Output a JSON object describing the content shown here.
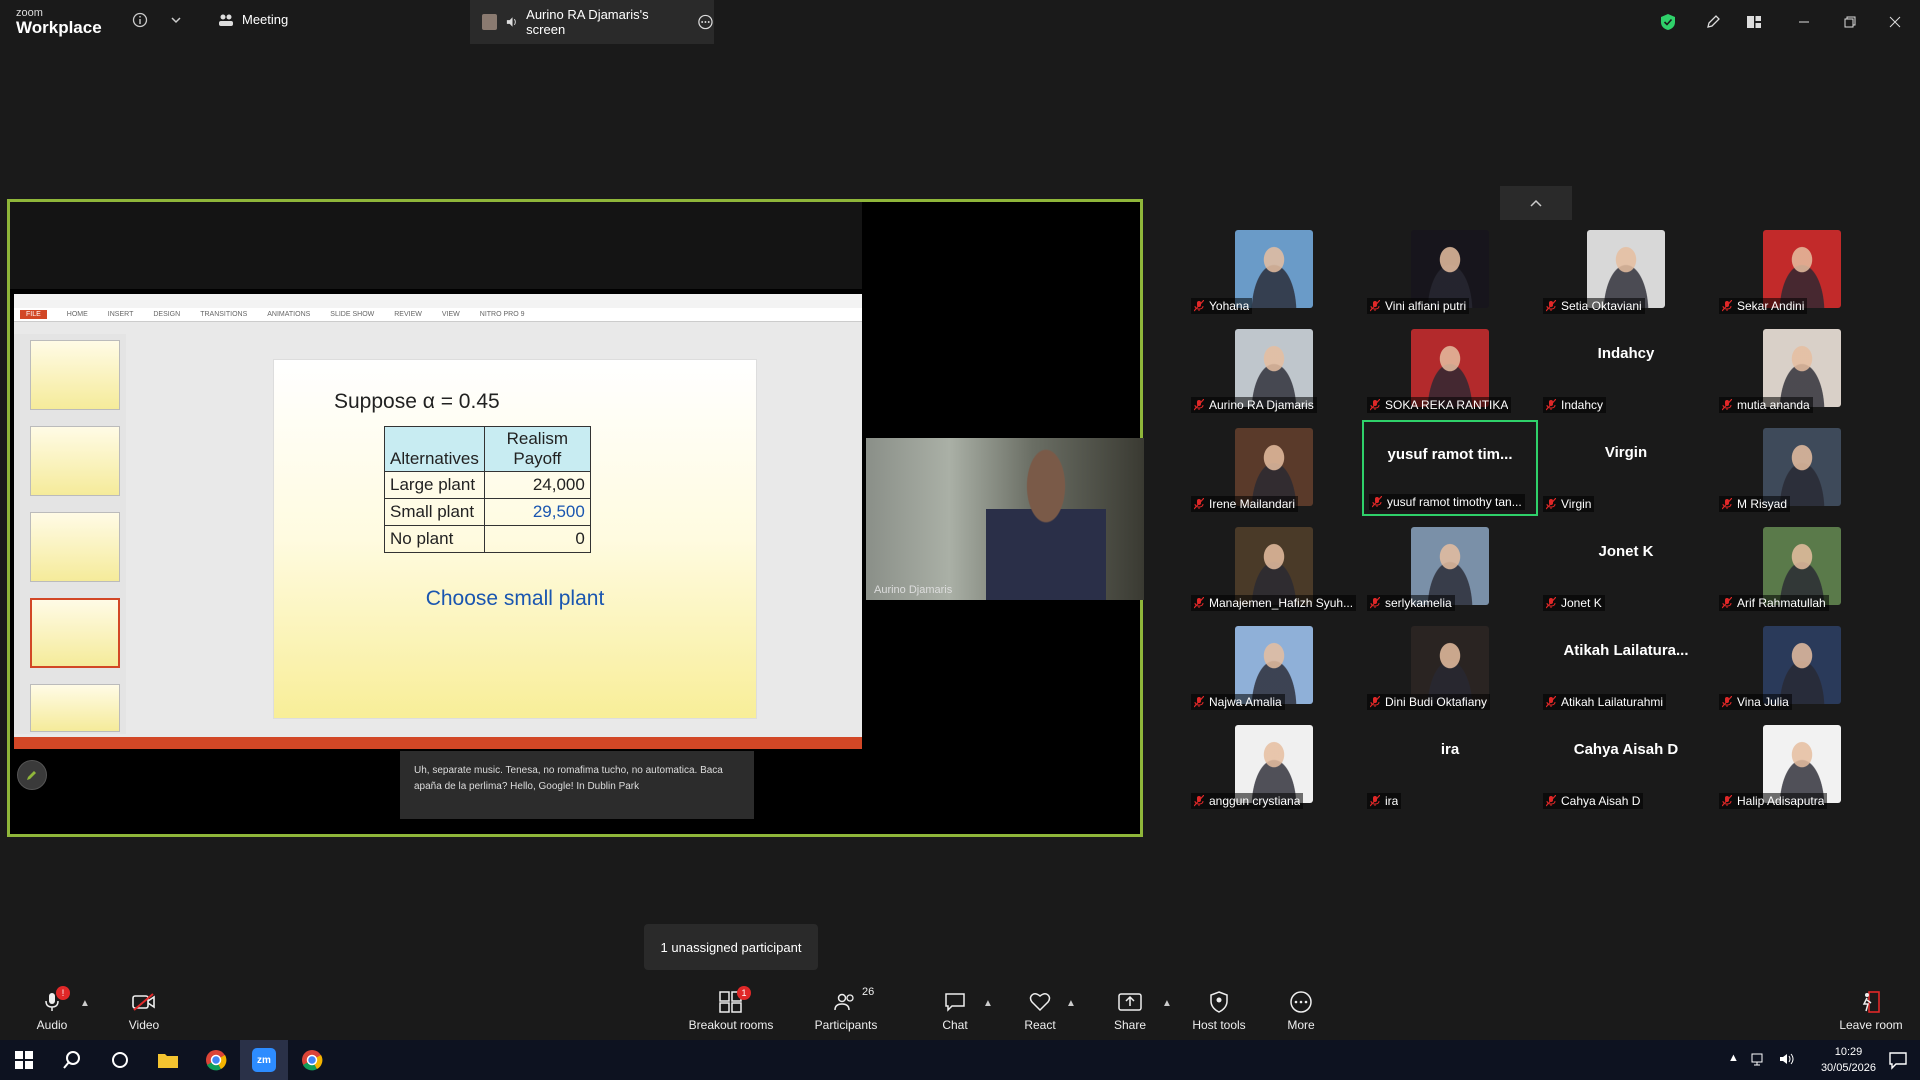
{
  "app": {
    "brand_top": "zoom",
    "brand_bottom": "Workplace"
  },
  "titlebar": {
    "meeting_label": "Meeting",
    "screen_tab_label": "Aurino RA Djamaris's screen"
  },
  "slide": {
    "heading": "Suppose α = 0.45",
    "table": {
      "col1_header": "Alternatives",
      "col2_header": "Realism Payoff",
      "rows": [
        {
          "alt": "Large plant",
          "val": "24,000"
        },
        {
          "alt": "Small plant",
          "val": "29,500"
        },
        {
          "alt": "No plant",
          "val": "0"
        }
      ]
    },
    "conclusion": "Choose small plant",
    "highlight_color": "#1a56b0"
  },
  "ppt": {
    "ribbon_tabs": [
      "FILE",
      "HOME",
      "INSERT",
      "DESIGN",
      "TRANSITIONS",
      "ANIMATIONS",
      "SLIDE SHOW",
      "REVIEW",
      "VIEW",
      "NITRO PRO 9"
    ]
  },
  "speaker": {
    "name": "Aurino Djamaris"
  },
  "caption": {
    "text": "Uh, separate music. Tenesa, no romafima tucho, no automatica. Baca apaña de la perlima? Hello, Google! In Dublin Park"
  },
  "participants": [
    {
      "name": "Yohana",
      "type": "photo",
      "color": "#6a9bc8"
    },
    {
      "name": "Vini alfiani putri",
      "type": "photo",
      "color": "#17151c"
    },
    {
      "name": "Setia Oktaviani",
      "type": "photo",
      "color": "#d8d8d8"
    },
    {
      "name": "Sekar Andini",
      "type": "photo",
      "color": "#c22a2a"
    },
    {
      "name": "Aurino RA Djamaris",
      "type": "photo",
      "color": "#bfc6cc"
    },
    {
      "name": "SOKA REKA RANTIKA",
      "type": "photo",
      "color": "#b32a2c"
    },
    {
      "name": "Indahcy",
      "type": "name",
      "big": "Indahcy"
    },
    {
      "name": "mutia ananda",
      "type": "photo",
      "color": "#d9d0c8"
    },
    {
      "name": "Irene Mailandari",
      "type": "photo",
      "color": "#5a3a2a"
    },
    {
      "name": "yusuf ramot timothy tan...",
      "type": "name",
      "big": "yusuf ramot tim...",
      "active": true
    },
    {
      "name": "Virgin",
      "type": "name",
      "big": "Virgin"
    },
    {
      "name": "M Risyad",
      "type": "photo",
      "color": "#3e4a5a"
    },
    {
      "name": "Manajemen_Hafizh Syuh...",
      "type": "photo",
      "color": "#4a3a28"
    },
    {
      "name": "serlykamelia",
      "type": "photo",
      "color": "#7a90a8"
    },
    {
      "name": "Jonet K",
      "type": "name",
      "big": "Jonet K"
    },
    {
      "name": "Arif Rahmatullah",
      "type": "photo",
      "color": "#5a7a4a"
    },
    {
      "name": "Najwa Amalia",
      "type": "photo",
      "color": "#8fb0d8"
    },
    {
      "name": "Dini Budi Oktafiany",
      "type": "photo",
      "color": "#2a2422"
    },
    {
      "name": "Atikah Lailaturahmi",
      "type": "name",
      "big": "Atikah Lailatura..."
    },
    {
      "name": "Vina Julia",
      "type": "photo",
      "color": "#2a3a5a"
    },
    {
      "name": "anggun crystiana",
      "type": "photo",
      "color": "#f0f0f0"
    },
    {
      "name": "ira",
      "type": "name",
      "big": "ira"
    },
    {
      "name": "Cahya Aisah D",
      "type": "name",
      "big": "Cahya Aisah D"
    },
    {
      "name": "Halip Adisaputra",
      "type": "photo",
      "color": "#f2f2f2"
    }
  ],
  "unassigned": "1 unassigned participant",
  "toolbar": {
    "audio": "Audio",
    "audio_badge": "!",
    "video": "Video",
    "breakout": "Breakout rooms",
    "breakout_badge": "1",
    "participants": "Participants",
    "participants_count": "26",
    "chat": "Chat",
    "react": "React",
    "share": "Share",
    "host_tools": "Host tools",
    "more": "More",
    "leave": "Leave room"
  },
  "clock": {
    "time": "10:29",
    "date": "30/05/2026"
  },
  "colors": {
    "accent_green": "#2fd16a",
    "frame_border": "#8fb63a",
    "mute_red": "#e02828"
  }
}
